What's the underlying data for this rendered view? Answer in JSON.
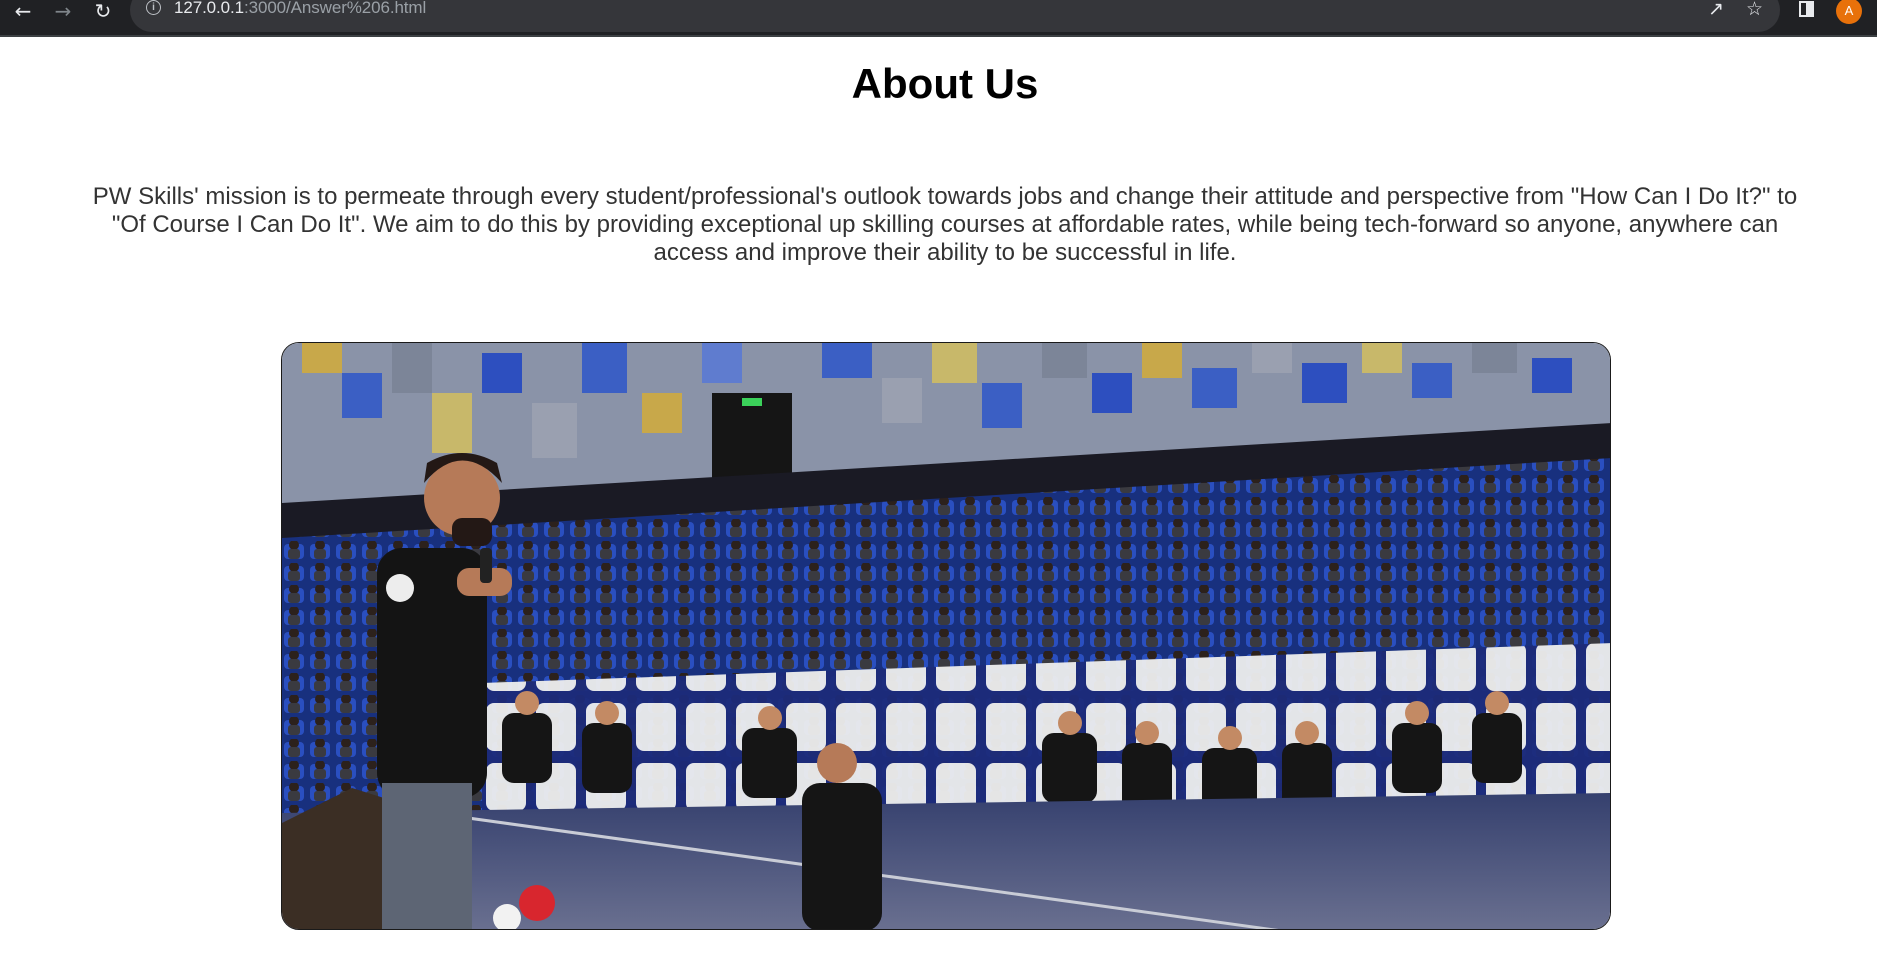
{
  "browser": {
    "url_host": "127.0.0.1",
    "url_path": ":3000/Answer%206.html",
    "avatar_letter": "A",
    "icons": [
      "back-icon",
      "forward-icon",
      "reload-icon",
      "site-info-icon",
      "share-icon",
      "bookmark-star-icon",
      "side-panel-icon"
    ]
  },
  "page": {
    "title": "About Us",
    "mission": "PW Skills' mission is to permeate through every student/professional's outlook towards jobs and change their attitude and perspective from \"How Can I Do It?\" to \"Of Course I Can Do It\". We aim to do this by providing exceptional up skilling courses at affordable rates, while being tech-forward so anyone, anywhere can access and improve their ability to be successful in life."
  },
  "colors": {
    "chrome": "#202124",
    "omnibox": "#35363a",
    "avatar": "#e8710a",
    "seat_blue": "#1f3fa8"
  }
}
